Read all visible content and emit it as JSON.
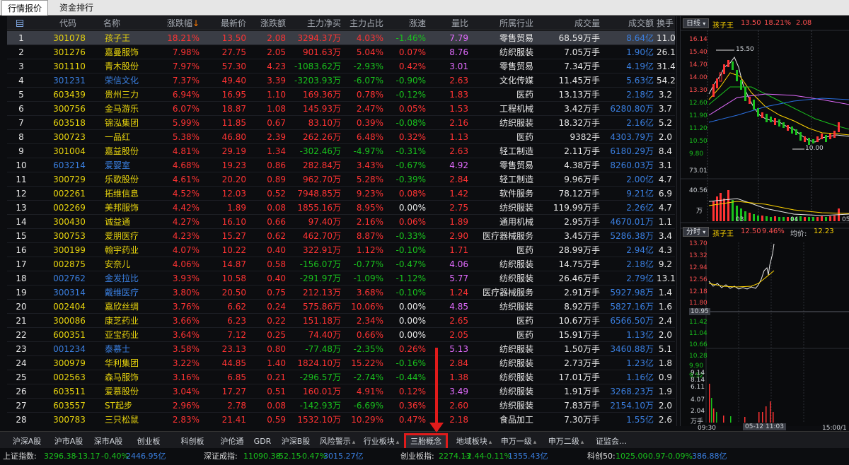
{
  "top_tabs": [
    "行情报价",
    "资金排行"
  ],
  "columns": [
    "",
    "代码",
    "名称",
    "涨跌幅",
    "最新价",
    "涨跌额",
    "主力净买",
    "主力占比",
    "涨速",
    "量比",
    "所属行业",
    "成交量",
    "成交额",
    "换手"
  ],
  "sort_indicator": "↓",
  "colors": {
    "up": "#ff3333",
    "down": "#19c21d",
    "accent": "#e01b1b"
  },
  "rows": [
    {
      "no": "1",
      "code": "301078",
      "name": "孩子王",
      "chg": "18.21%",
      "price": "13.50",
      "amt": "2.08",
      "main": "3294.37万",
      "ratio": "4.03%",
      "speed": "-1.46%",
      "vr": "7.79",
      "ind": "零售贸易",
      "vol": "68.59万手",
      "turn": "8.64亿",
      "hs": "11.0"
    },
    {
      "no": "2",
      "code": "301276",
      "name": "嘉曼服饰",
      "chg": "7.98%",
      "price": "27.75",
      "amt": "2.05",
      "main": "901.63万",
      "ratio": "5.04%",
      "speed": "0.07%",
      "vr": "8.76",
      "ind": "纺织服装",
      "vol": "7.05万手",
      "turn": "1.90亿",
      "hs": "26.1"
    },
    {
      "no": "3",
      "code": "301110",
      "name": "青木股份",
      "chg": "7.97%",
      "price": "57.30",
      "amt": "4.23",
      "main": "-1083.62万",
      "ratio": "-2.93%",
      "speed": "0.42%",
      "vr": "3.01",
      "ind": "零售贸易",
      "vol": "7.34万手",
      "turn": "4.19亿",
      "hs": "31.4"
    },
    {
      "no": "4",
      "code": "301231",
      "name": "荣信文化",
      "chg": "7.37%",
      "price": "49.40",
      "amt": "3.39",
      "main": "-3203.93万",
      "ratio": "-6.07%",
      "speed": "-0.90%",
      "vr": "2.63",
      "ind": "文化传媒",
      "vol": "11.45万手",
      "turn": "5.63亿",
      "hs": "54.2"
    },
    {
      "no": "5",
      "code": "603439",
      "name": "贵州三力",
      "chg": "6.94%",
      "price": "16.95",
      "amt": "1.10",
      "main": "169.36万",
      "ratio": "0.78%",
      "speed": "-0.12%",
      "vr": "1.83",
      "ind": "医药",
      "vol": "13.13万手",
      "turn": "2.18亿",
      "hs": "3.2"
    },
    {
      "no": "6",
      "code": "300756",
      "name": "金马游乐",
      "chg": "6.07%",
      "price": "18.87",
      "amt": "1.08",
      "main": "145.93万",
      "ratio": "2.47%",
      "speed": "0.05%",
      "vr": "1.53",
      "ind": "工程机械",
      "vol": "3.42万手",
      "turn": "6280.80万",
      "hs": "3.7"
    },
    {
      "no": "7",
      "code": "603518",
      "name": "锦泓集团",
      "chg": "5.99%",
      "price": "11.85",
      "amt": "0.67",
      "main": "83.10万",
      "ratio": "0.39%",
      "speed": "-0.08%",
      "vr": "2.16",
      "ind": "纺织服装",
      "vol": "18.32万手",
      "turn": "2.16亿",
      "hs": "5.2"
    },
    {
      "no": "8",
      "code": "300723",
      "name": "一品红",
      "chg": "5.38%",
      "price": "46.80",
      "amt": "2.39",
      "main": "262.26万",
      "ratio": "6.48%",
      "speed": "0.32%",
      "vr": "1.13",
      "ind": "医药",
      "vol": "9382手",
      "turn": "4303.79万",
      "hs": "2.0"
    },
    {
      "no": "9",
      "code": "301004",
      "name": "嘉益股份",
      "chg": "4.81%",
      "price": "29.19",
      "amt": "1.34",
      "main": "-302.46万",
      "ratio": "-4.97%",
      "speed": "-0.31%",
      "vr": "2.63",
      "ind": "轻工制造",
      "vol": "2.11万手",
      "turn": "6180.29万",
      "hs": "8.4"
    },
    {
      "no": "10",
      "code": "603214",
      "name": "爱婴室",
      "chg": "4.68%",
      "price": "19.23",
      "amt": "0.86",
      "main": "282.84万",
      "ratio": "3.43%",
      "speed": "-0.67%",
      "vr": "4.92",
      "ind": "零售贸易",
      "vol": "4.38万手",
      "turn": "8260.03万",
      "hs": "3.1"
    },
    {
      "no": "11",
      "code": "300729",
      "name": "乐歌股份",
      "chg": "4.61%",
      "price": "20.20",
      "amt": "0.89",
      "main": "962.70万",
      "ratio": "5.28%",
      "speed": "-0.39%",
      "vr": "2.84",
      "ind": "轻工制造",
      "vol": "9.96万手",
      "turn": "2.00亿",
      "hs": "4.7"
    },
    {
      "no": "12",
      "code": "002261",
      "name": "拓维信息",
      "chg": "4.52%",
      "price": "12.03",
      "amt": "0.52",
      "main": "7948.85万",
      "ratio": "9.23%",
      "speed": "0.08%",
      "vr": "1.42",
      "ind": "软件服务",
      "vol": "78.12万手",
      "turn": "9.21亿",
      "hs": "6.9"
    },
    {
      "no": "13",
      "code": "002269",
      "name": "美邦服饰",
      "chg": "4.42%",
      "price": "1.89",
      "amt": "0.08",
      "main": "1855.16万",
      "ratio": "8.95%",
      "speed": "0.00%",
      "vr": "2.75",
      "ind": "纺织服装",
      "vol": "119.99万手",
      "turn": "2.26亿",
      "hs": "4.7"
    },
    {
      "no": "14",
      "code": "300430",
      "name": "诚益通",
      "chg": "4.27%",
      "price": "16.10",
      "amt": "0.66",
      "main": "97.40万",
      "ratio": "2.16%",
      "speed": "0.06%",
      "vr": "1.89",
      "ind": "通用机械",
      "vol": "2.95万手",
      "turn": "4670.01万",
      "hs": "1.1"
    },
    {
      "no": "15",
      "code": "300753",
      "name": "爱朋医疗",
      "chg": "4.23%",
      "price": "15.27",
      "amt": "0.62",
      "main": "462.70万",
      "ratio": "8.87%",
      "speed": "-0.33%",
      "vr": "2.90",
      "ind": "医疗器械服务",
      "vol": "3.45万手",
      "turn": "5286.38万",
      "hs": "3.4"
    },
    {
      "no": "16",
      "code": "300199",
      "name": "翰宇药业",
      "chg": "4.07%",
      "price": "10.22",
      "amt": "0.40",
      "main": "322.91万",
      "ratio": "1.12%",
      "speed": "-0.10%",
      "vr": "1.71",
      "ind": "医药",
      "vol": "28.99万手",
      "turn": "2.94亿",
      "hs": "4.3"
    },
    {
      "no": "17",
      "code": "002875",
      "name": "安奈儿",
      "chg": "4.06%",
      "price": "14.87",
      "amt": "0.58",
      "main": "-156.07万",
      "ratio": "-0.77%",
      "speed": "-0.47%",
      "vr": "4.06",
      "ind": "纺织服装",
      "vol": "14.75万手",
      "turn": "2.18亿",
      "hs": "9.2"
    },
    {
      "no": "18",
      "code": "002762",
      "name": "金发拉比",
      "chg": "3.93%",
      "price": "10.58",
      "amt": "0.40",
      "main": "-291.97万",
      "ratio": "-1.09%",
      "speed": "-1.12%",
      "vr": "5.77",
      "ind": "纺织服装",
      "vol": "26.46万手",
      "turn": "2.79亿",
      "hs": "13.1"
    },
    {
      "no": "19",
      "code": "300314",
      "name": "戴维医疗",
      "chg": "3.80%",
      "price": "20.50",
      "amt": "0.75",
      "main": "212.13万",
      "ratio": "3.68%",
      "speed": "-0.10%",
      "vr": "1.24",
      "ind": "医疗器械服务",
      "vol": "2.91万手",
      "turn": "5927.98万",
      "hs": "1.4"
    },
    {
      "no": "20",
      "code": "002404",
      "name": "嘉欣丝绸",
      "chg": "3.76%",
      "price": "6.62",
      "amt": "0.24",
      "main": "575.86万",
      "ratio": "10.06%",
      "speed": "0.00%",
      "vr": "4.85",
      "ind": "纺织服装",
      "vol": "8.92万手",
      "turn": "5827.16万",
      "hs": "1.6"
    },
    {
      "no": "21",
      "code": "300086",
      "name": "康芝药业",
      "chg": "3.66%",
      "price": "6.23",
      "amt": "0.22",
      "main": "151.18万",
      "ratio": "2.34%",
      "speed": "0.00%",
      "vr": "2.65",
      "ind": "医药",
      "vol": "10.67万手",
      "turn": "6566.50万",
      "hs": "2.4"
    },
    {
      "no": "22",
      "code": "600351",
      "name": "亚宝药业",
      "chg": "3.64%",
      "price": "7.12",
      "amt": "0.25",
      "main": "74.40万",
      "ratio": "0.66%",
      "speed": "0.00%",
      "vr": "2.05",
      "ind": "医药",
      "vol": "15.91万手",
      "turn": "1.13亿",
      "hs": "2.0"
    },
    {
      "no": "23",
      "code": "001234",
      "name": "泰慕士",
      "chg": "3.58%",
      "price": "23.13",
      "amt": "0.80",
      "main": "-77.48万",
      "ratio": "-2.35%",
      "speed": "0.26%",
      "vr": "5.13",
      "ind": "纺织服装",
      "vol": "1.50万手",
      "turn": "3460.88万",
      "hs": "5.1"
    },
    {
      "no": "24",
      "code": "300979",
      "name": "华利集团",
      "chg": "3.22%",
      "price": "44.85",
      "amt": "1.40",
      "main": "1824.10万",
      "ratio": "15.22%",
      "speed": "-0.16%",
      "vr": "2.84",
      "ind": "纺织服装",
      "vol": "2.73万手",
      "turn": "1.23亿",
      "hs": "1.8"
    },
    {
      "no": "25",
      "code": "002563",
      "name": "森马服饰",
      "chg": "3.16%",
      "price": "6.85",
      "amt": "0.21",
      "main": "-296.57万",
      "ratio": "-2.74%",
      "speed": "-0.44%",
      "vr": "1.38",
      "ind": "纺织服装",
      "vol": "17.01万手",
      "turn": "1.16亿",
      "hs": "0.9"
    },
    {
      "no": "26",
      "code": "603511",
      "name": "爱慕股份",
      "chg": "3.04%",
      "price": "17.27",
      "amt": "0.51",
      "main": "160.01万",
      "ratio": "4.91%",
      "speed": "0.12%",
      "vr": "3.49",
      "ind": "纺织服装",
      "vol": "1.91万手",
      "turn": "3268.23万",
      "hs": "1.9"
    },
    {
      "no": "27",
      "code": "603557",
      "name": "ST起步",
      "chg": "2.96%",
      "price": "2.78",
      "amt": "0.08",
      "main": "-142.93万",
      "ratio": "-6.69%",
      "speed": "0.36%",
      "vr": "2.60",
      "ind": "纺织服装",
      "vol": "7.83万手",
      "turn": "2154.10万",
      "hs": "2.0"
    },
    {
      "no": "28",
      "code": "300783",
      "name": "三只松鼠",
      "chg": "2.83%",
      "price": "21.41",
      "amt": "0.59",
      "main": "1532.10万",
      "ratio": "10.29%",
      "speed": "0.47%",
      "vr": "2.18",
      "ind": "食品加工",
      "vol": "7.30万手",
      "turn": "1.55亿",
      "hs": "2.6"
    }
  ],
  "daily": {
    "tab": "日线",
    "stock": "孩子王",
    "price": "13.50",
    "pct": "18.21%",
    "amt": "2.08",
    "ylabels": [
      "16.14",
      "15.40",
      "14.70",
      "14.00",
      "13.30",
      "12.60",
      "11.90",
      "11.20",
      "10.50",
      "9.80"
    ],
    "vol_labels": [
      "73.01",
      "40.56",
      "万"
    ],
    "dates": [
      "03",
      "04",
      "05"
    ],
    "high": "15.50",
    "low": "10.00"
  },
  "intraday": {
    "tab": "分时",
    "stock": "孩子王",
    "price": "12.50",
    "pct": "9.46%",
    "avg_label": "均价:",
    "avg": "12.23",
    "ylabels_red": [
      "13.70",
      "13.32",
      "12.94",
      "12.56",
      "12.18",
      "11.80"
    ],
    "mid": "10.95",
    "ylabels_green": [
      "11.42",
      "11.04",
      "10.66",
      "10.28",
      "9.90",
      "9.52"
    ],
    "vol_labels": [
      "9.14",
      "8.14",
      "6.11",
      "4.07",
      "2.04",
      "万手"
    ],
    "times": [
      "09:30",
      "05-12 11:03",
      "15:00/1"
    ]
  },
  "bottom_tabs": [
    "沪深A股",
    "沪市A股",
    "深市A股",
    "创业板",
    "科创板",
    "沪伦通",
    "GDR",
    "沪深B股",
    "风险警示",
    "行业板块",
    "三胎概念",
    "地域板块",
    "申万一级",
    "申万二级",
    "证监会…"
  ],
  "status": {
    "sh_label": "上证指数:",
    "sh_val": "3296.38",
    "sh_chg": "-13.17",
    "sh_pct": "-0.40%",
    "sh_amt": "2446.95亿",
    "sz_label": "深证成指:",
    "sz_val": "11090.38",
    "sz_chg": "-52.15",
    "sz_pct": "-0.47%",
    "sz_amt": "3015.27亿",
    "cy_label": "创业板指:",
    "cy_val": "2274.13",
    "cy_chg": "-2.44",
    "cy_pct": "-0.11%",
    "cy_amt": "1355.43亿",
    "kc_label": "科创50:",
    "kc_val": "1025.00",
    "kc_chg": "-0.97",
    "kc_pct": "-0.09%",
    "kc_amt": "386.88亿"
  }
}
